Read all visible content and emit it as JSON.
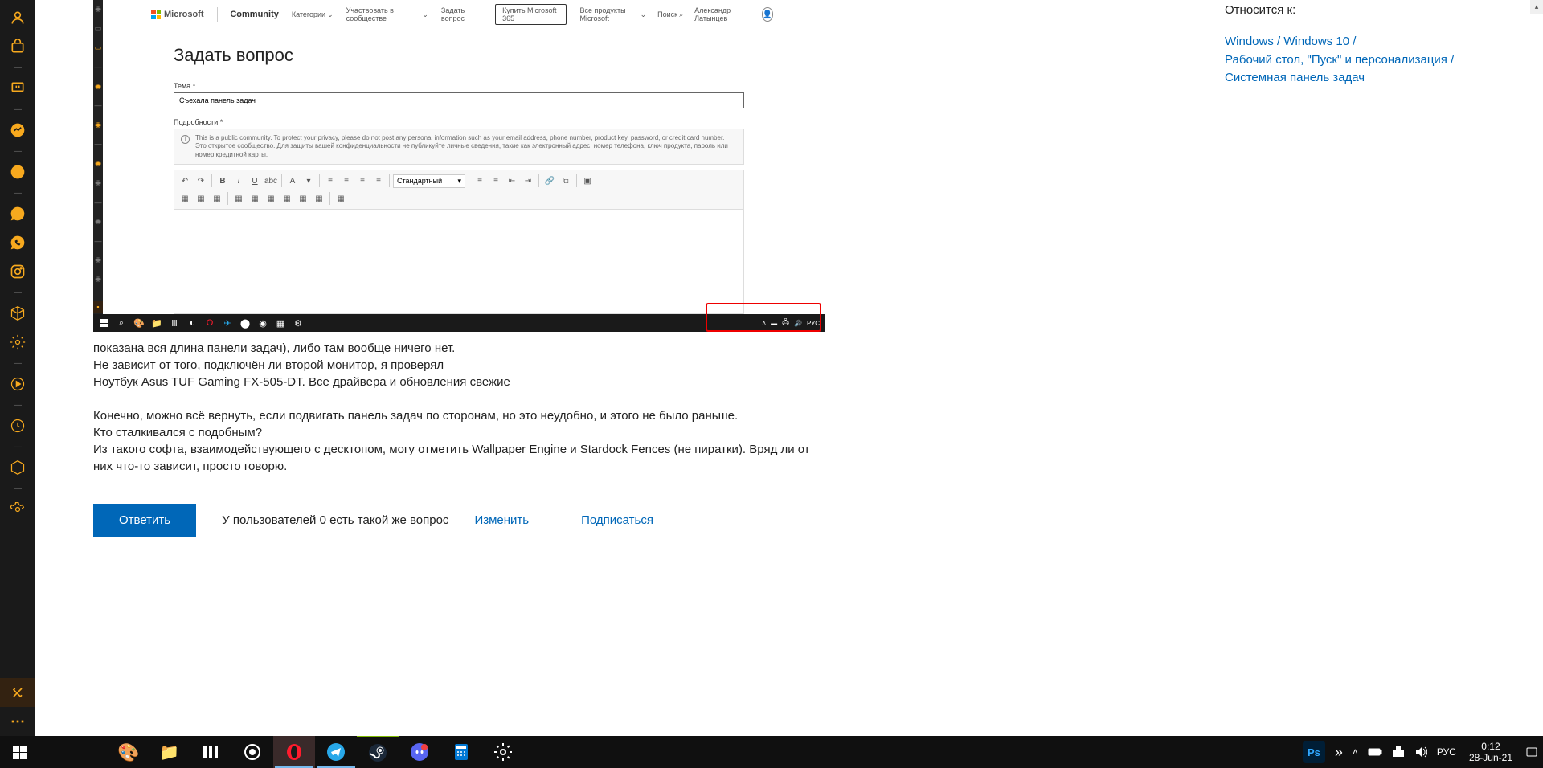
{
  "sidebar_icons": [
    "user",
    "bag",
    "box",
    "twitch",
    "sep",
    "msg",
    "sep",
    "whatsapp",
    "sep",
    "msg2",
    "camera",
    "sep",
    "whatsapp2",
    "sep",
    "insta",
    "sep",
    "cube",
    "sep",
    "gear",
    "sep",
    "play",
    "sep",
    "clock",
    "sep",
    "cube2",
    "sep",
    "gear2"
  ],
  "sidebar_bottom": [
    "tools",
    "more"
  ],
  "embedded": {
    "logo": "Microsoft",
    "community": "Community",
    "nav": [
      "Категории",
      "Участвовать в сообществе",
      "Задать вопрос"
    ],
    "buy": "Купить Microsoft 365",
    "right_nav": "Все продукты Microsoft",
    "search": "Поиск",
    "user": "Александр Латынцев",
    "title": "Задать вопрос",
    "theme_label": "Тема",
    "theme_value": "Съехала панель задач",
    "details_label": "Подробности",
    "info_en": "This is a public community. To protect your privacy, please do not post any personal information such as your email address, phone number, product key, password, or credit card number.",
    "info_ru": "Это открытое сообщество. Для защиты вашей конфиденциальности не публикуйте личные сведения, такие как электронный адрес, номер телефона, ключ продукта, пароль или номер кредитной карты.",
    "style_select": "Стандартный",
    "tb_lang": "РУС"
  },
  "post": {
    "l1": "показана вся длина панели задач), либо там вообще ничего нет.",
    "l2": "Не зависит от того, подключён ли второй монитор, я проверял",
    "l3": "Ноутбук Asus TUF Gaming FX-505-DT. Все драйвера и обновления свежие",
    "l4": "Конечно, можно всё вернуть, если подвигать панель задач по сторонам, но это неудобно, и этого не было раньше.",
    "l5": "Кто сталкивался с подобным?",
    "l6": "Из такого софта, взаимодействующего с десктопом, могу отметить Wallpaper Engine и Stardock Fences (не пиратки). Вряд ли от них что-то зависит, просто говорю."
  },
  "actions": {
    "reply": "Ответить",
    "same": "У пользователей 0 есть такой же вопрос",
    "edit": "Изменить",
    "subscribe": "Подписаться"
  },
  "related": {
    "title": "Относится к:",
    "links": [
      "Windows",
      "Windows 10",
      "Рабочий стол, \"Пуск\" и персонализация",
      "Системная панель задач"
    ],
    "sep": "/"
  },
  "taskbar": {
    "lang": "РУС",
    "time": "0:12",
    "date": "28-Jun-21"
  }
}
